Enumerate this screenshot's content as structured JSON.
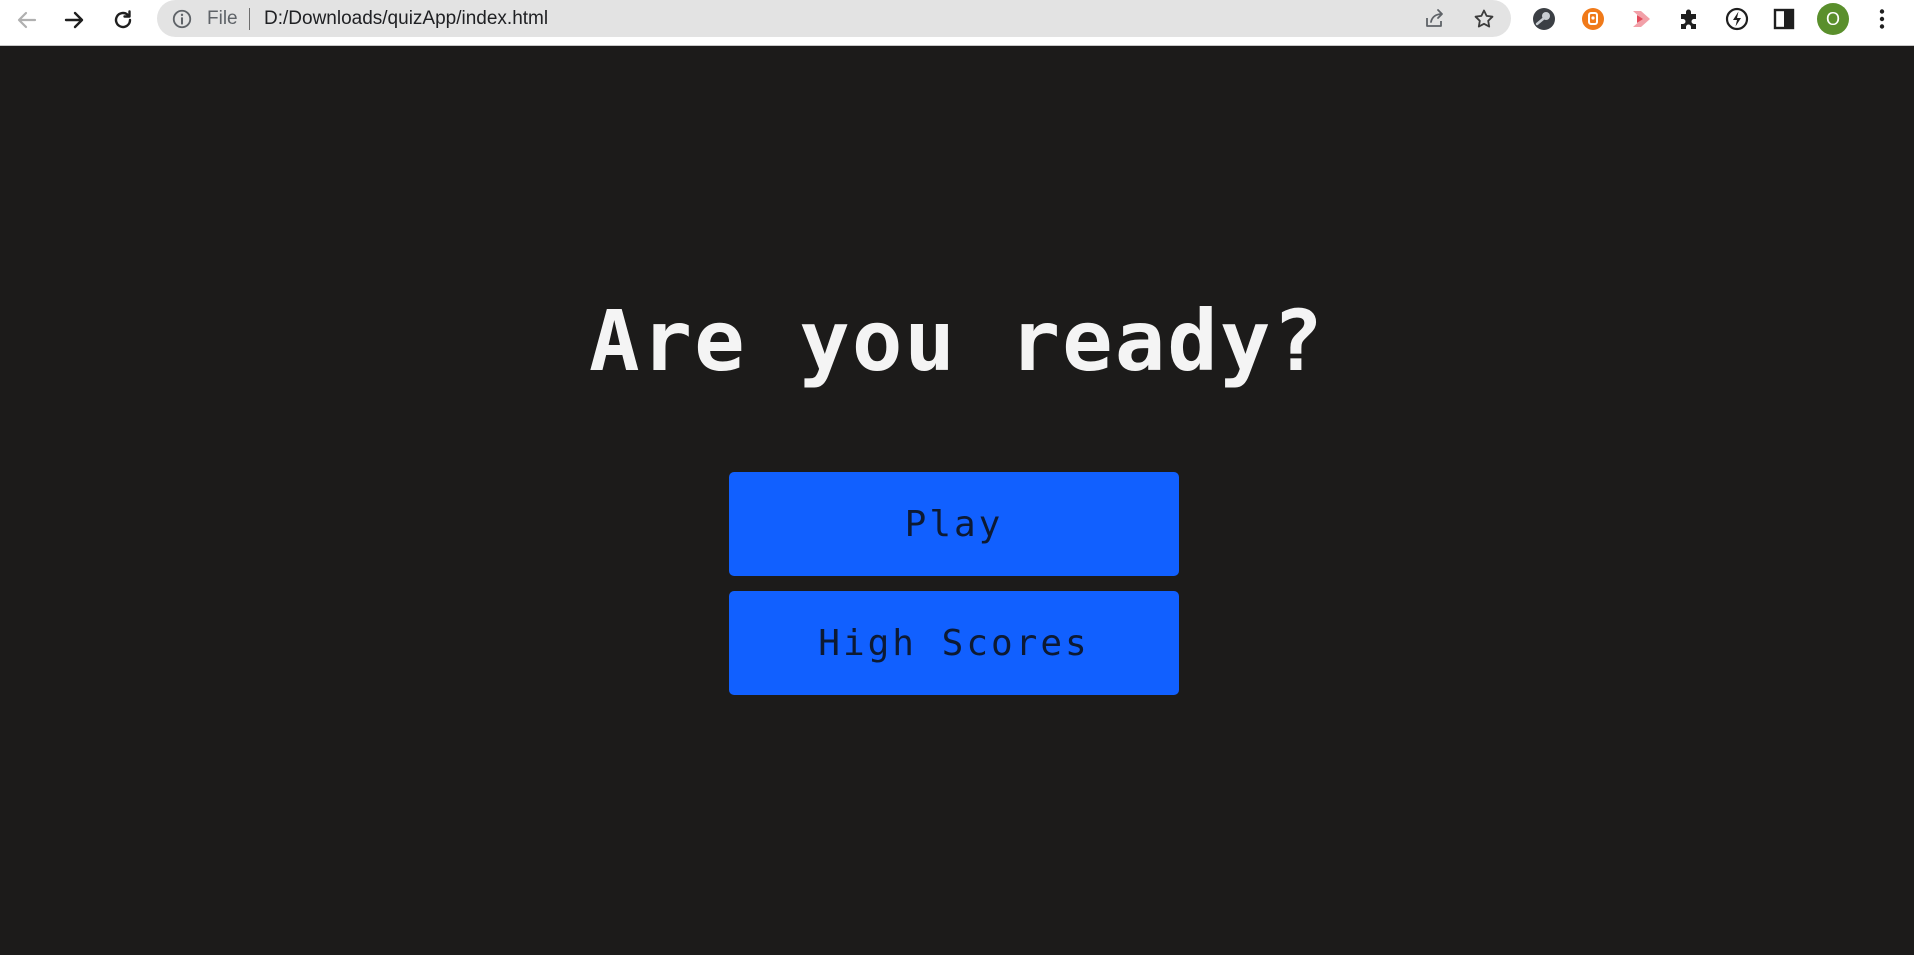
{
  "browser": {
    "scheme_label": "File",
    "url": "D:/Downloads/quizApp/index.html",
    "profile_initial": "O",
    "icons": {
      "back": "back-arrow-icon",
      "forward": "forward-arrow-icon",
      "reload": "reload-icon",
      "info": "info-icon",
      "share": "share-icon",
      "bookmark": "star-icon",
      "extensions": [
        "extension-dark-icon",
        "extension-orange-icon",
        "extension-pink-play-icon",
        "puzzle-icon",
        "lightning-icon",
        "side-panel-icon"
      ],
      "menu": "kebab-menu-icon"
    }
  },
  "quiz": {
    "heading": "Are you ready?",
    "play_label": "Play",
    "high_scores_label": "High Scores"
  },
  "colors": {
    "background": "#1c1b1a",
    "button": "#1160ff",
    "button_text": "#0d1a33",
    "heading_text": "#f4f4f4",
    "avatar": "#5a8f2c"
  }
}
